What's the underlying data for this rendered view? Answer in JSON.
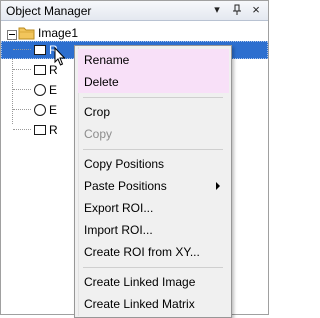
{
  "panel": {
    "title": "Object Manager",
    "buttons": {
      "dropdown": "▾",
      "pin": "📌",
      "close": "×"
    }
  },
  "tree": {
    "root": {
      "label": "Image1",
      "icon": "folder-icon",
      "expander": "minus"
    },
    "children": [
      {
        "label": "R",
        "icon": "rectangle-icon",
        "selected": true
      },
      {
        "label": "R",
        "icon": "rectangle-icon",
        "selected": false
      },
      {
        "label": "E",
        "icon": "ellipse-icon",
        "selected": false
      },
      {
        "label": "E",
        "icon": "ellipse-icon",
        "selected": false
      },
      {
        "label": "R",
        "icon": "rectangle-icon",
        "selected": false
      }
    ]
  },
  "context_menu": {
    "items": [
      {
        "label": "Rename",
        "enabled": true,
        "highlight": true
      },
      {
        "label": "Delete",
        "enabled": true,
        "highlight": true
      },
      {
        "label": "Crop",
        "enabled": true
      },
      {
        "label": "Copy",
        "enabled": false
      },
      {
        "label": "Copy Positions",
        "enabled": true
      },
      {
        "label": "Paste Positions",
        "enabled": true,
        "submenu": true
      },
      {
        "label": "Export ROI...",
        "enabled": true
      },
      {
        "label": "Import ROI...",
        "enabled": true
      },
      {
        "label": "Create ROI from XY...",
        "enabled": true
      },
      {
        "label": "Create Linked Image",
        "enabled": true
      },
      {
        "label": "Create Linked Matrix",
        "enabled": true
      }
    ]
  },
  "colors": {
    "selection": "#2d6fcf",
    "menu_highlight": "#f8e0f8",
    "menu_background": "#f0f0f0",
    "disabled_text": "#8d8d8d"
  }
}
